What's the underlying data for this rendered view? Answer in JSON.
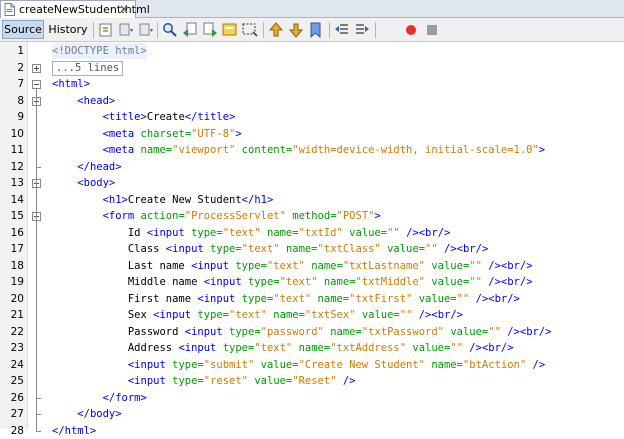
{
  "file_tab": {
    "name": "createNewStudent.html"
  },
  "toolbar": {
    "source_label": "Source",
    "history_label": "History"
  },
  "editor": {
    "lines": [
      {
        "num": "1",
        "fold": "none",
        "parts": [
          [
            "d",
            "<!DOCTYPE html>"
          ]
        ]
      },
      {
        "num": "2",
        "fold": "plus",
        "parts": [
          [
            "c",
            "...5 lines"
          ]
        ]
      },
      {
        "num": "7",
        "fold": "minus",
        "parts": [
          [
            "t",
            "<html>"
          ]
        ]
      },
      {
        "num": "8",
        "fold": "minus",
        "parts": [
          [
            "s",
            "    "
          ],
          [
            "t",
            "<head>"
          ]
        ]
      },
      {
        "num": "9",
        "fold": "none",
        "parts": [
          [
            "s",
            "        "
          ],
          [
            "t",
            "<title>"
          ],
          [
            "x",
            "Create"
          ],
          [
            "t",
            "</title>"
          ]
        ]
      },
      {
        "num": "10",
        "fold": "none",
        "parts": [
          [
            "s",
            "        "
          ],
          [
            "t",
            "<meta "
          ],
          [
            "a",
            "charset="
          ],
          [
            "v",
            "\"UTF-8\""
          ],
          [
            "t",
            ">"
          ]
        ]
      },
      {
        "num": "11",
        "fold": "none",
        "parts": [
          [
            "s",
            "        "
          ],
          [
            "t",
            "<meta "
          ],
          [
            "a",
            "name="
          ],
          [
            "v",
            "\"viewport\""
          ],
          [
            "x",
            " "
          ],
          [
            "a",
            "content="
          ],
          [
            "v",
            "\"width=device-width, initial-scale=1.0\""
          ],
          [
            "t",
            ">"
          ]
        ]
      },
      {
        "num": "12",
        "fold": "end",
        "parts": [
          [
            "s",
            "    "
          ],
          [
            "t",
            "</head>"
          ]
        ]
      },
      {
        "num": "13",
        "fold": "minus",
        "parts": [
          [
            "s",
            "    "
          ],
          [
            "t",
            "<body>"
          ]
        ]
      },
      {
        "num": "14",
        "fold": "none",
        "parts": [
          [
            "s",
            "        "
          ],
          [
            "t",
            "<h1>"
          ],
          [
            "x",
            "Create New Student"
          ],
          [
            "t",
            "</h1>"
          ]
        ]
      },
      {
        "num": "15",
        "fold": "minus",
        "parts": [
          [
            "s",
            "        "
          ],
          [
            "t",
            "<form "
          ],
          [
            "a",
            "action="
          ],
          [
            "v",
            "\"ProcessServlet\""
          ],
          [
            "x",
            " "
          ],
          [
            "a",
            "method="
          ],
          [
            "v",
            "\"POST\""
          ],
          [
            "t",
            ">"
          ]
        ]
      },
      {
        "num": "16",
        "fold": "none",
        "parts": [
          [
            "s",
            "            "
          ],
          [
            "x",
            "Id "
          ],
          [
            "t",
            "<input "
          ],
          [
            "a",
            "type="
          ],
          [
            "v",
            "\"text\""
          ],
          [
            "x",
            " "
          ],
          [
            "a",
            "name="
          ],
          [
            "v",
            "\"txtId\""
          ],
          [
            "x",
            " "
          ],
          [
            "a",
            "value="
          ],
          [
            "v",
            "\"\""
          ],
          [
            "x",
            " "
          ],
          [
            "t",
            "/><br/>"
          ]
        ]
      },
      {
        "num": "17",
        "fold": "none",
        "parts": [
          [
            "s",
            "            "
          ],
          [
            "x",
            "Class "
          ],
          [
            "t",
            "<input "
          ],
          [
            "a",
            "type="
          ],
          [
            "v",
            "\"text\""
          ],
          [
            "x",
            " "
          ],
          [
            "a",
            "name="
          ],
          [
            "v",
            "\"txtClass\""
          ],
          [
            "x",
            " "
          ],
          [
            "a",
            "value="
          ],
          [
            "v",
            "\"\""
          ],
          [
            "x",
            " "
          ],
          [
            "t",
            "/><br/>"
          ]
        ]
      },
      {
        "num": "18",
        "fold": "none",
        "parts": [
          [
            "s",
            "            "
          ],
          [
            "x",
            "Last name "
          ],
          [
            "t",
            "<input "
          ],
          [
            "a",
            "type="
          ],
          [
            "v",
            "\"text\""
          ],
          [
            "x",
            " "
          ],
          [
            "a",
            "name="
          ],
          [
            "v",
            "\"txtLastname\""
          ],
          [
            "x",
            " "
          ],
          [
            "a",
            "value="
          ],
          [
            "v",
            "\"\""
          ],
          [
            "x",
            " "
          ],
          [
            "t",
            "/><br/>"
          ]
        ]
      },
      {
        "num": "19",
        "fold": "none",
        "parts": [
          [
            "s",
            "            "
          ],
          [
            "x",
            "Middle name "
          ],
          [
            "t",
            "<input "
          ],
          [
            "a",
            "type="
          ],
          [
            "v",
            "\"text\""
          ],
          [
            "x",
            " "
          ],
          [
            "a",
            "name="
          ],
          [
            "v",
            "\"txtMiddle\""
          ],
          [
            "x",
            " "
          ],
          [
            "a",
            "value="
          ],
          [
            "v",
            "\"\""
          ],
          [
            "x",
            " "
          ],
          [
            "t",
            "/><br/>"
          ]
        ]
      },
      {
        "num": "20",
        "fold": "none",
        "parts": [
          [
            "s",
            "            "
          ],
          [
            "x",
            "First name "
          ],
          [
            "t",
            "<input "
          ],
          [
            "a",
            "type="
          ],
          [
            "v",
            "\"text\""
          ],
          [
            "x",
            " "
          ],
          [
            "a",
            "name="
          ],
          [
            "v",
            "\"txtFirst\""
          ],
          [
            "x",
            " "
          ],
          [
            "a",
            "value="
          ],
          [
            "v",
            "\"\""
          ],
          [
            "x",
            " "
          ],
          [
            "t",
            "/><br/>"
          ]
        ]
      },
      {
        "num": "21",
        "fold": "none",
        "parts": [
          [
            "s",
            "            "
          ],
          [
            "x",
            "Sex "
          ],
          [
            "t",
            "<input "
          ],
          [
            "a",
            "type="
          ],
          [
            "v",
            "\"text\""
          ],
          [
            "x",
            " "
          ],
          [
            "a",
            "name="
          ],
          [
            "v",
            "\"txtSex\""
          ],
          [
            "x",
            " "
          ],
          [
            "a",
            "value="
          ],
          [
            "v",
            "\"\""
          ],
          [
            "x",
            " "
          ],
          [
            "t",
            "/><br/>"
          ]
        ]
      },
      {
        "num": "22",
        "fold": "none",
        "parts": [
          [
            "s",
            "            "
          ],
          [
            "x",
            "Password "
          ],
          [
            "t",
            "<input "
          ],
          [
            "a",
            "type="
          ],
          [
            "v",
            "\"password\""
          ],
          [
            "x",
            " "
          ],
          [
            "a",
            "name="
          ],
          [
            "v",
            "\"txtPassword\""
          ],
          [
            "x",
            " "
          ],
          [
            "a",
            "value="
          ],
          [
            "v",
            "\"\""
          ],
          [
            "x",
            " "
          ],
          [
            "t",
            "/><br/>"
          ]
        ]
      },
      {
        "num": "23",
        "fold": "none",
        "parts": [
          [
            "s",
            "            "
          ],
          [
            "x",
            "Address "
          ],
          [
            "t",
            "<input "
          ],
          [
            "a",
            "type="
          ],
          [
            "v",
            "\"text\""
          ],
          [
            "x",
            " "
          ],
          [
            "a",
            "name="
          ],
          [
            "v",
            "\"txtAddress\""
          ],
          [
            "x",
            " "
          ],
          [
            "a",
            "value="
          ],
          [
            "v",
            "\"\""
          ],
          [
            "x",
            " "
          ],
          [
            "t",
            "/><br/>"
          ]
        ]
      },
      {
        "num": "24",
        "fold": "none",
        "parts": [
          [
            "s",
            "            "
          ],
          [
            "t",
            "<input "
          ],
          [
            "a",
            "type="
          ],
          [
            "v",
            "\"submit\""
          ],
          [
            "x",
            " "
          ],
          [
            "a",
            "value="
          ],
          [
            "v",
            "\"Create New Student\""
          ],
          [
            "x",
            " "
          ],
          [
            "a",
            "name="
          ],
          [
            "v",
            "\"btAction\""
          ],
          [
            "x",
            " "
          ],
          [
            "t",
            "/>"
          ]
        ]
      },
      {
        "num": "25",
        "fold": "none",
        "parts": [
          [
            "s",
            "            "
          ],
          [
            "t",
            "<input "
          ],
          [
            "a",
            "type="
          ],
          [
            "v",
            "\"reset\""
          ],
          [
            "x",
            " "
          ],
          [
            "a",
            "value="
          ],
          [
            "v",
            "\"Reset\""
          ],
          [
            "x",
            " "
          ],
          [
            "t",
            "/>"
          ]
        ]
      },
      {
        "num": "26",
        "fold": "end",
        "parts": [
          [
            "s",
            "        "
          ],
          [
            "t",
            "</form>"
          ]
        ]
      },
      {
        "num": "27",
        "fold": "end",
        "parts": [
          [
            "s",
            "    "
          ],
          [
            "t",
            "</body>"
          ]
        ]
      },
      {
        "num": "28",
        "fold": "end",
        "parts": [
          [
            "t",
            "</html>"
          ]
        ]
      }
    ]
  }
}
